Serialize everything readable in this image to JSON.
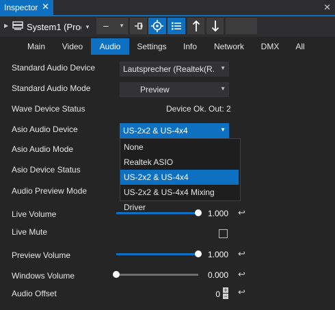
{
  "panel": {
    "title": "Inspector",
    "close_glyph": "✕",
    "panel_close_glyph": "✕"
  },
  "toolbar": {
    "device_name": "System1 (Prog",
    "dash_label": "–",
    "icons": [
      "server-icon",
      "pin-icon",
      "crosshair-icon",
      "list-icon",
      "arrow-up-icon",
      "arrow-down-icon"
    ]
  },
  "tabs": [
    "Main",
    "Video",
    "Audio",
    "Settings",
    "Info",
    "Network",
    "DMX",
    "All"
  ],
  "active_tab": "Audio",
  "rows": {
    "standard_audio_device": {
      "label": "Standard Audio Device",
      "value": "Lautsprecher (Realtek(R..."
    },
    "standard_audio_mode": {
      "label": "Standard Audio Mode",
      "value": "Preview"
    },
    "wave_device_status": {
      "label": "Wave Device Status",
      "value": "Device Ok. Out: 2"
    },
    "asio_audio_device": {
      "label": "Asio Audio Device",
      "value": "US-2x2 & US-4x4"
    },
    "asio_audio_mode": {
      "label": "Asio Audio Mode"
    },
    "asio_device_status": {
      "label": "Asio Device Status"
    },
    "audio_preview_mode": {
      "label": "Audio Preview Mode"
    },
    "live_volume": {
      "label": "Live Volume",
      "value": "1.000",
      "level": 1.0
    },
    "live_mute": {
      "label": "Live Mute",
      "checked": false
    },
    "preview_volume": {
      "label": "Preview Volume",
      "value": "1.000",
      "level": 1.0
    },
    "windows_volume": {
      "label": "Windows Volume",
      "value": "0.000",
      "level": 0.0
    },
    "audio_offset": {
      "label": "Audio Offset",
      "value": "0"
    }
  },
  "asio_dropdown": {
    "options": [
      "None",
      "Realtek ASIO",
      "US-2x2 & US-4x4",
      "US-2x2 & US-4x4 Mixing Driver"
    ],
    "highlighted": "US-2x2 & US-4x4"
  },
  "glyphs": {
    "reset": "↩",
    "dropdown_arrow": "▼",
    "plus": "+",
    "minus": "−"
  },
  "colors": {
    "accent": "#0e70c0",
    "background": "#252526",
    "toolbar": "#2d2d30"
  }
}
